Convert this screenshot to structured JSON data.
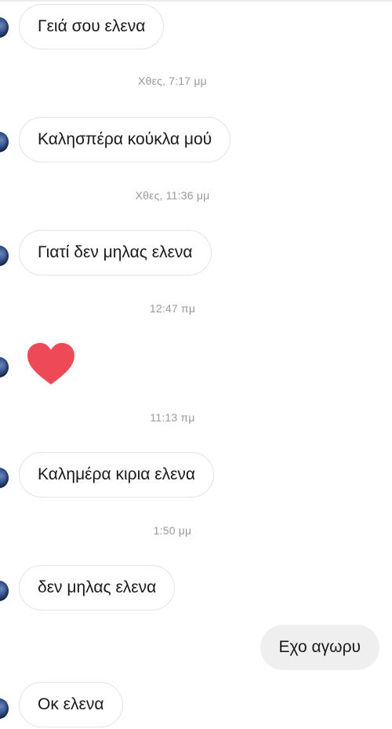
{
  "thread": {
    "messages": [
      {
        "text": "Γειά σου ελενα"
      },
      {
        "text": "Καλησπέρα κούκλα μού"
      },
      {
        "text": "Γιατί δεν μηλας ελενα"
      },
      {
        "text": "Καλημέρα κιρια ελενα"
      },
      {
        "text": "δεν μηλας ελενα"
      },
      {
        "text": "Εχο αγωρυ"
      },
      {
        "text": "Οκ ελενα"
      }
    ],
    "timestamps": [
      "Χθες, 7:17 μμ",
      "Χθες, 11:36 μμ",
      "12:47 πμ",
      "11:13 πμ",
      "1:50 μμ"
    ],
    "heart_icon": "heart-icon",
    "heart_color": "#ed4956",
    "avatar_icon": "avatar"
  }
}
